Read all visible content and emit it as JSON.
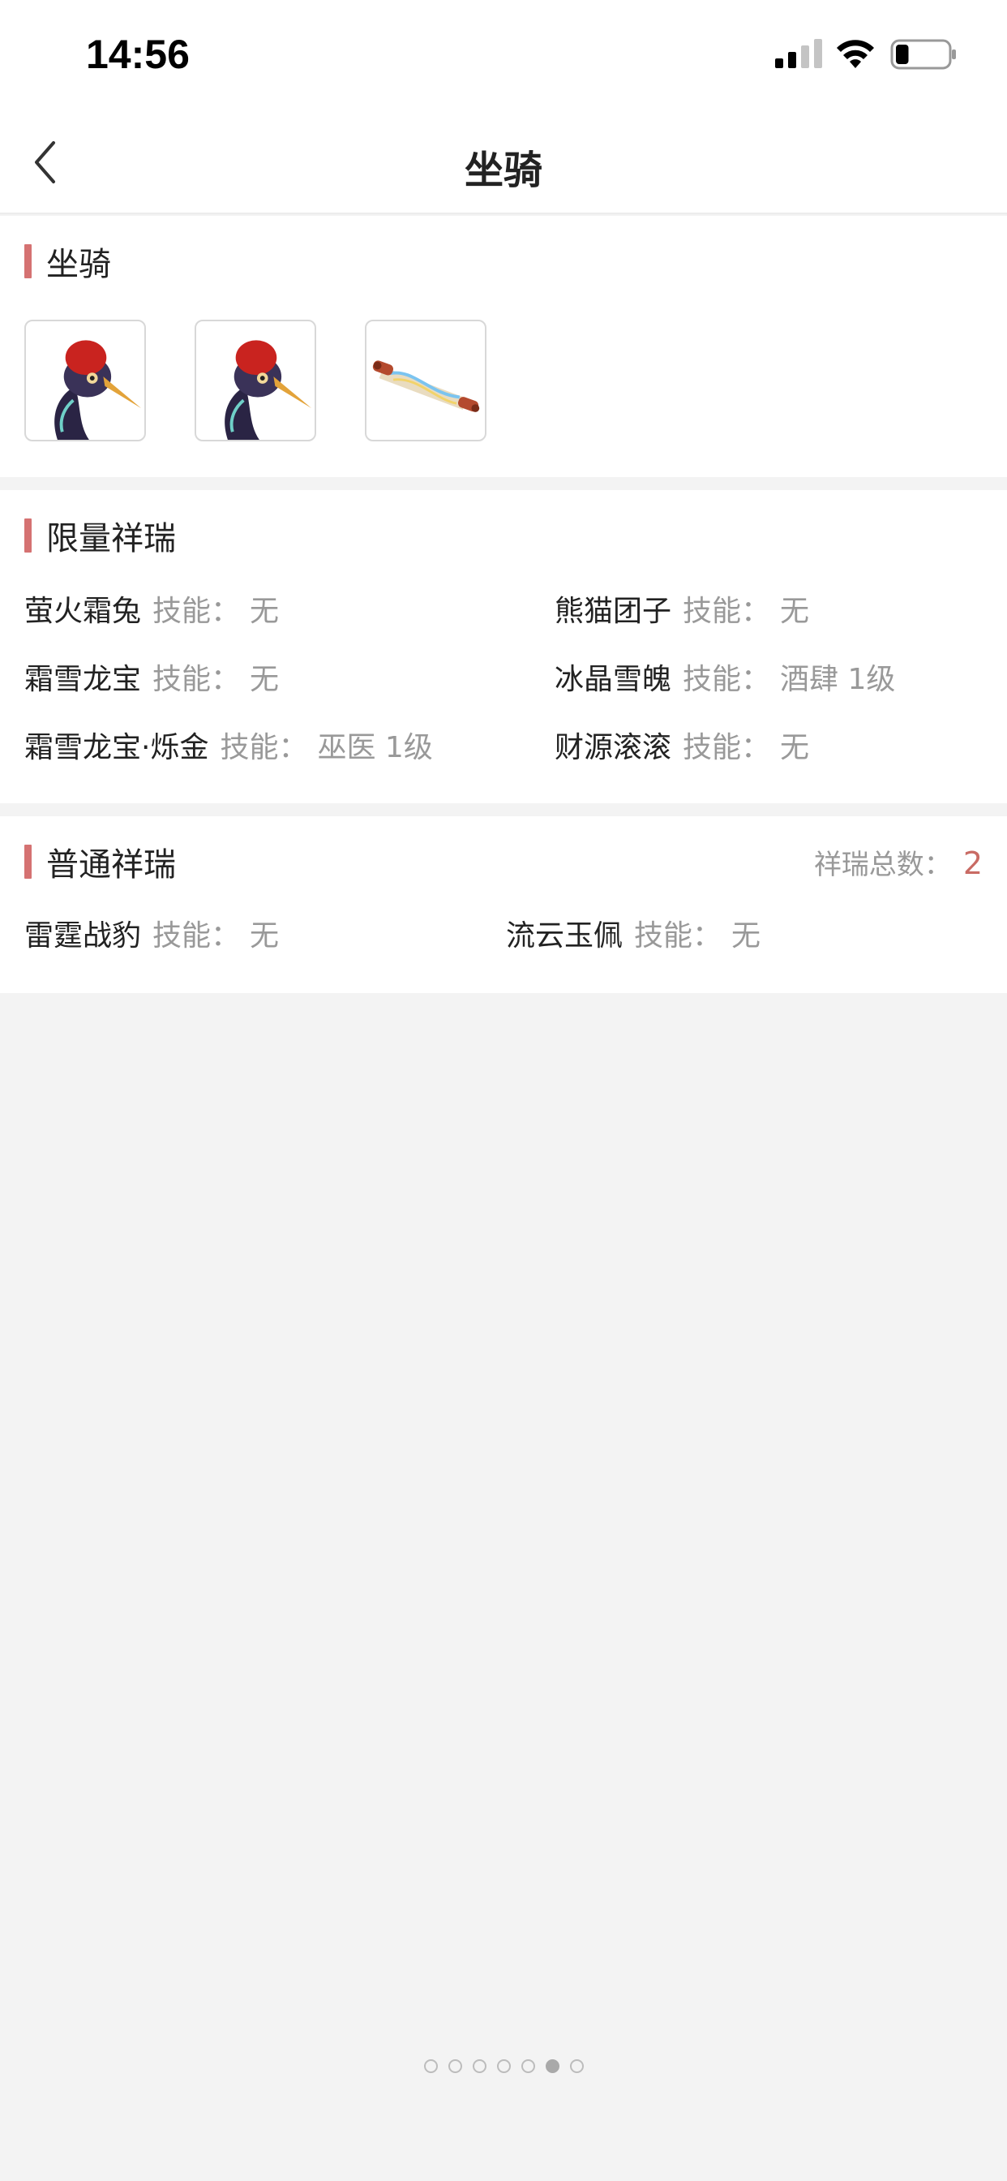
{
  "status_bar": {
    "time": "14:56",
    "battery_level": 0.25
  },
  "nav": {
    "title": "坐骑"
  },
  "mounts": {
    "title": "坐骑",
    "thumbnails": [
      {
        "icon": "crane-mount-icon"
      },
      {
        "icon": "crane-mount-icon"
      },
      {
        "icon": "scroll-mount-icon"
      }
    ]
  },
  "limited": {
    "title": "限量祥瑞",
    "items": [
      {
        "name": "萤火霜兔",
        "skill_label": "技能：",
        "skill": "无"
      },
      {
        "name": "熊猫团子",
        "skill_label": "技能：",
        "skill": "无"
      },
      {
        "name": "霜雪龙宝",
        "skill_label": "技能：",
        "skill": "无"
      },
      {
        "name": "冰晶雪魄",
        "skill_label": "技能：",
        "skill": "酒肆 1级"
      },
      {
        "name": "霜雪龙宝·烁金",
        "skill_label": "技能：",
        "skill": "巫医 1级"
      },
      {
        "name": "财源滚滚",
        "skill_label": "技能：",
        "skill": "无"
      }
    ]
  },
  "common": {
    "title": "普通祥瑞",
    "total_label": "祥瑞总数：",
    "total_value": "2",
    "items": [
      {
        "name": "雷霆战豹",
        "skill_label": "技能：",
        "skill": "无"
      },
      {
        "name": "流云玉佩",
        "skill_label": "技能：",
        "skill": "无"
      }
    ]
  },
  "pagination": {
    "total": 7,
    "active_index": 5
  },
  "colors": {
    "accent": "#d57272",
    "total_value": "#c96b64",
    "muted": "#999999"
  }
}
